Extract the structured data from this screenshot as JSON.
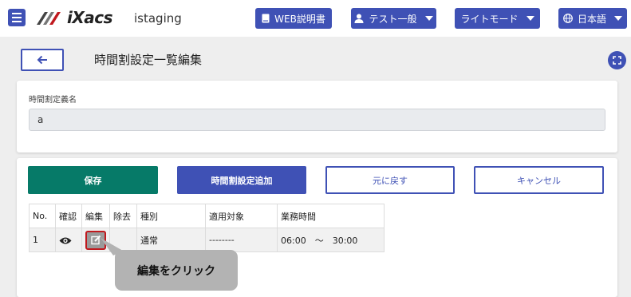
{
  "header": {
    "logo_text": "iXacs",
    "env_name": "istaging",
    "manual_label": "WEB説明書",
    "user_label": "テスト一般",
    "theme_label": "ライトモード",
    "lang_label": "日本語",
    "accent": "#3f51b5"
  },
  "page": {
    "title": "時間割設定一覧編集"
  },
  "name_field": {
    "label": "時間割定義名",
    "value": "a"
  },
  "actions": {
    "save": "保存",
    "add": "時間割設定追加",
    "undo": "元に戻す",
    "cancel": "キャンセル",
    "save_color": "#067a68"
  },
  "table": {
    "headers": {
      "no": "No.",
      "view": "確認",
      "edit": "編集",
      "delete": "除去",
      "kind": "種別",
      "target": "適用対象",
      "hours": "業務時間"
    },
    "rows": [
      {
        "no": "1",
        "kind": "通常",
        "target": "--------",
        "hours": "06:00　～　30:00"
      }
    ]
  },
  "callout": {
    "text": "編集をクリック",
    "highlight": "#c0191e"
  },
  "icons": [
    "menu-icon",
    "book-icon",
    "user-icon",
    "globe-icon",
    "arrow-left-icon",
    "fullscreen-icon",
    "eye-icon",
    "edit-icon"
  ]
}
